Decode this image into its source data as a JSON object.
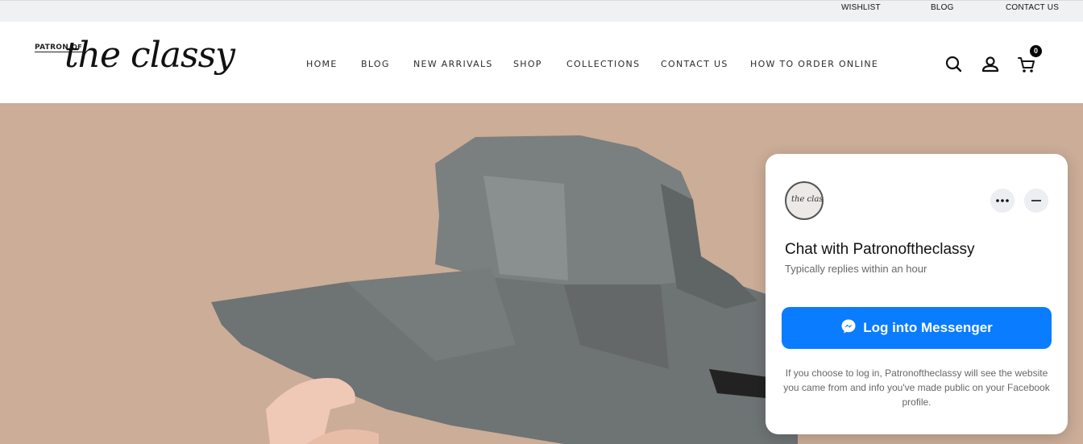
{
  "topbar": {
    "wishlist": "WISHLIST",
    "blog": "BLOG",
    "contact": "CONTACT US"
  },
  "logo": {
    "patron": "PATRON",
    "of": "OF",
    "script": "the classy"
  },
  "nav": {
    "items": [
      "HOME",
      "BLOG",
      "NEW ARRIVALS",
      "SHOP",
      "COLLECTIONS",
      "CONTACT US",
      "HOW TO ORDER ONLINE"
    ]
  },
  "header_icons": {
    "search": "search-icon",
    "account": "user-icon",
    "cart": "cart-icon",
    "cart_count": "0"
  },
  "hero": {
    "background_color": "#cbad98",
    "hat_color": "#6f7475"
  },
  "chat": {
    "avatar_text": "the classy",
    "title": "Chat with Patronoftheclassy",
    "subtitle": "Typically replies within an hour",
    "login_label": "Log into Messenger",
    "note": "If you choose to log in, Patronoftheclassy will see the website you came from and info you've made public on your Facebook profile.",
    "accent_color": "#0a7cff"
  }
}
